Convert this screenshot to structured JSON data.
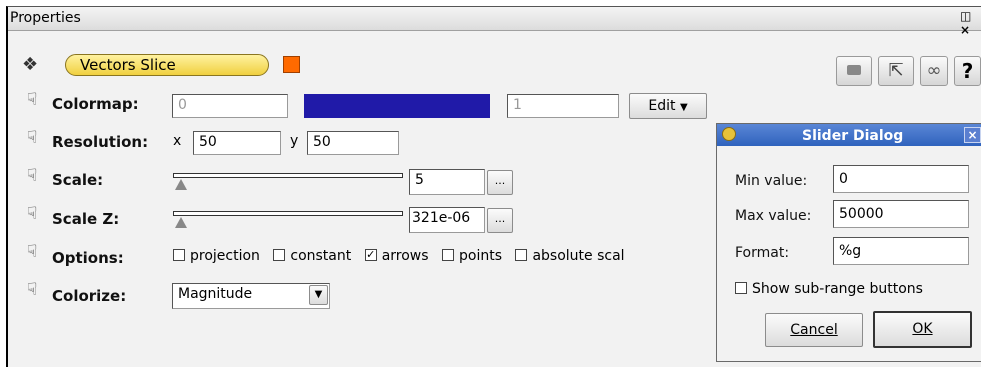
{
  "panel": {
    "title": "Properties",
    "window_controls": "\u0001 ×"
  },
  "object": {
    "name": "Vectors Slice",
    "color": "#ff6a00"
  },
  "toolbar": {
    "icons": [
      "camera-icon",
      "pointer-icon",
      "link-icon",
      "help-icon"
    ],
    "help_label": "?"
  },
  "colormap": {
    "label": "Colormap:",
    "min": "0",
    "max": "1",
    "bar_color": "#201aa8",
    "edit_label": "Edit"
  },
  "resolution": {
    "label": "Resolution:",
    "x_label": "x",
    "x_value": "50",
    "y_label": "y",
    "y_value": "50"
  },
  "scale": {
    "label": "Scale:",
    "value": "5",
    "dots": "..."
  },
  "scale_z": {
    "label": "Scale Z:",
    "value": "321e-06",
    "dots": "..."
  },
  "options": {
    "label": "Options:",
    "items": [
      {
        "label": "projection",
        "checked": false
      },
      {
        "label": "constant",
        "checked": false
      },
      {
        "label": "arrows",
        "checked": true
      },
      {
        "label": "points",
        "checked": false
      },
      {
        "label": "absolute scal",
        "checked": false
      }
    ]
  },
  "colorize": {
    "label": "Colorize:",
    "value": "Magnitude"
  },
  "slider_dialog": {
    "title": "Slider Dialog",
    "min_label": "Min value:",
    "min_value": "0",
    "max_label": "Max value:",
    "max_value": "50000",
    "format_label": "Format:",
    "format_value": "%g",
    "subrange_label": "Show sub-range buttons",
    "cancel_label": "Cancel",
    "ok_label": "OK"
  }
}
